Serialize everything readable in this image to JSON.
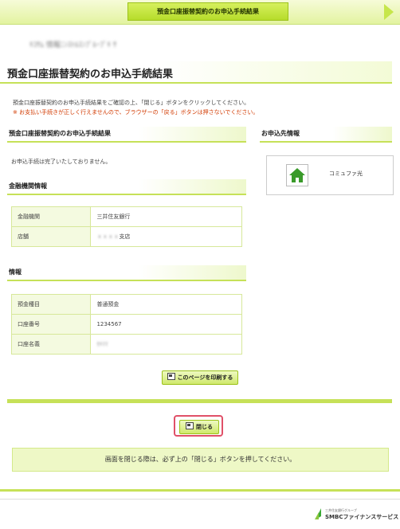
{
  "header": {
    "step_label": "預金口座振替契約のお申込手続結果"
  },
  "user": {
    "masked_name": "ｷｺｻﾑ 情報ﾆﾝｽﾄﾙｽﾝﾌﾟﾙｰﾌﾟｷ ｻ"
  },
  "page": {
    "title": "預金口座振替契約のお申込手続結果"
  },
  "intro": {
    "line1": "預金口座振替契約のお申込手続結果をご確認の上、「閉じる」ボタンをクリックしてください。",
    "warning": "※ お支払い手続きが正しく行えませんので、ブラウザーの「戻る」ボタンは押さないでください。"
  },
  "result": {
    "heading": "預金口座振替契約のお申込手続結果",
    "message": "お申込手続は完了いたしておりません。"
  },
  "bank": {
    "heading": "金融機関情報",
    "rows": [
      {
        "key": "金融機関",
        "value": "三井住友銀行",
        "masked": false
      },
      {
        "key": "店舗",
        "value": "支店",
        "masked_prefix": "ｘｘｘｘ"
      }
    ]
  },
  "account": {
    "heading": "情報",
    "rows": [
      {
        "key": "預金種目",
        "value": "普通預金"
      },
      {
        "key": "口座番号",
        "value": "1234567"
      },
      {
        "key": "口座名義",
        "value": "ｾｷﾏﾏ"
      }
    ]
  },
  "actions": {
    "print_label": "このページを印刷する",
    "close_label": "閉じる"
  },
  "sidebar": {
    "heading": "お申込先情報",
    "merchant": "コミュファ光",
    "merchant_icon": "home-icon"
  },
  "notice": {
    "text": "画面を閉じる際は、必ず上の「閉じる」ボタンを押してください。"
  },
  "footer": {
    "group_label": "三井住友銀行グループ",
    "company": "SMBCファイナンスサービス"
  },
  "colors": {
    "accent": "#c6e158",
    "warning": "#d23a00",
    "close_highlight": "#e05068"
  }
}
